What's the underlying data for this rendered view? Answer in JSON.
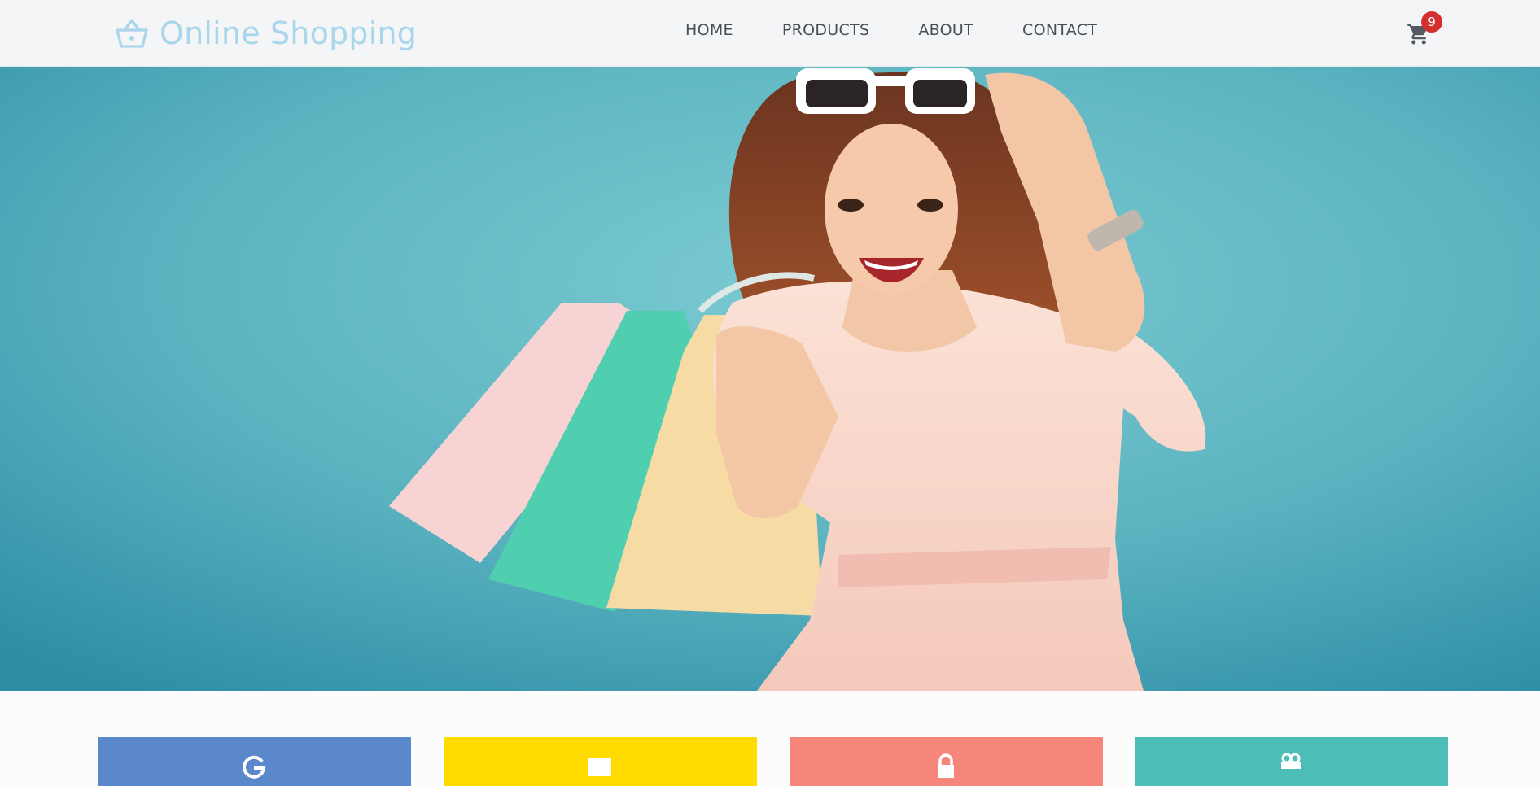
{
  "brand": {
    "name": "Online Shopping",
    "icon": "basket-icon",
    "color": "#a9d6ea"
  },
  "nav": {
    "items": [
      {
        "label": "HOME"
      },
      {
        "label": "PRODUCTS"
      },
      {
        "label": "ABOUT"
      },
      {
        "label": "CONTACT"
      }
    ]
  },
  "cart": {
    "icon": "cart-icon",
    "count": "9",
    "badge_color": "#d32f2f"
  },
  "hero": {
    "image": "woman-with-shopping-bags",
    "background_color": "#5db5c2"
  },
  "categories": [
    {
      "icon": "google-icon",
      "color": "#5b87cb"
    },
    {
      "icon": "folder-icon",
      "color": "#ffdc00"
    },
    {
      "icon": "lock-icon",
      "color": "#f7867a"
    },
    {
      "icon": "gift-icon",
      "color": "#4dbdb7"
    }
  ]
}
